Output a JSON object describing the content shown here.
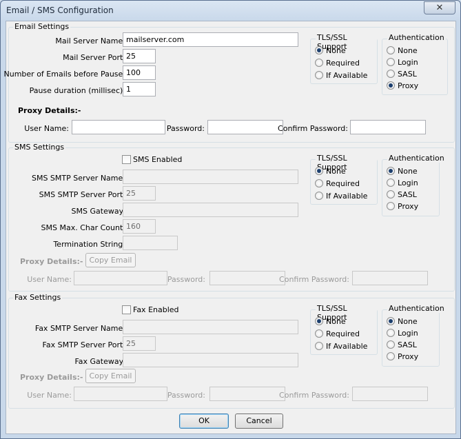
{
  "window": {
    "title": "Email / SMS Configuration",
    "close_glyph": "✕"
  },
  "email": {
    "legend": "Email Settings",
    "mail_server_name_label": "Mail Server Name:",
    "mail_server_name": "mailserver.com",
    "mail_server_port_label": "Mail Server Port:",
    "mail_server_port": "25",
    "emails_before_pause_label": "Number of Emails before Pause:",
    "emails_before_pause": "100",
    "pause_duration_label": "Pause duration (millisec):",
    "pause_duration": "1",
    "proxy_details_label": "Proxy Details:-",
    "user_name_label": "User Name:",
    "password_label": "Password:",
    "confirm_password_label": "Confirm Password:",
    "tls": {
      "title": "TLS/SSL Support",
      "options": [
        "None",
        "Required",
        "If Available"
      ],
      "selected": "None"
    },
    "auth": {
      "title": "Authentication",
      "options": [
        "None",
        "Login",
        "SASL",
        "Proxy"
      ],
      "selected": "Proxy"
    }
  },
  "sms": {
    "legend": "SMS Settings",
    "enabled_label": "SMS Enabled",
    "server_name_label": "SMS SMTP Server Name:",
    "server_port_label": "SMS SMTP Server Port:",
    "server_port": "25",
    "gateway_label": "SMS Gateway:",
    "max_char_label": "SMS Max. Char Count:",
    "max_char": "160",
    "termination_label": "Termination String:",
    "proxy_details_label": "Proxy Details:-",
    "copy_email_label": "Copy Email",
    "user_name_label": "User Name:",
    "password_label": "Password:",
    "confirm_password_label": "Confirm Password:",
    "tls": {
      "title": "TLS/SSL Support",
      "options": [
        "None",
        "Required",
        "If Available"
      ],
      "selected": "None"
    },
    "auth": {
      "title": "Authentication",
      "options": [
        "None",
        "Login",
        "SASL",
        "Proxy"
      ],
      "selected": "None"
    }
  },
  "fax": {
    "legend": "Fax Settings",
    "enabled_label": "Fax Enabled",
    "server_name_label": "Fax SMTP Server Name:",
    "server_port_label": "Fax SMTP Server Port:",
    "server_port": "25",
    "gateway_label": "Fax Gateway:",
    "proxy_details_label": "Proxy Details:-",
    "copy_email_label": "Copy Email",
    "user_name_label": "User Name:",
    "password_label": "Password:",
    "confirm_password_label": "Confirm Password:",
    "tls": {
      "title": "TLS/SSL Support",
      "options": [
        "None",
        "Required",
        "If Available"
      ],
      "selected": "None"
    },
    "auth": {
      "title": "Authentication",
      "options": [
        "None",
        "Login",
        "SASL",
        "Proxy"
      ],
      "selected": "None"
    }
  },
  "buttons": {
    "ok": "OK",
    "cancel": "Cancel"
  }
}
